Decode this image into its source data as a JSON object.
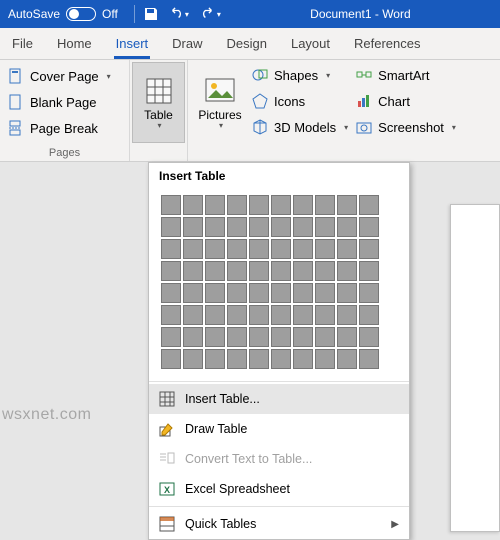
{
  "titlebar": {
    "autosave": {
      "label": "AutoSave",
      "state": "Off"
    },
    "document_title": "Document1 - Word"
  },
  "tabs": {
    "file": "File",
    "home": "Home",
    "insert": "Insert",
    "draw": "Draw",
    "design": "Design",
    "layout": "Layout",
    "references": "References"
  },
  "ribbon": {
    "pages": {
      "label": "Pages",
      "cover_page": "Cover Page",
      "blank_page": "Blank Page",
      "page_break": "Page Break"
    },
    "table_btn": {
      "label": "Table"
    },
    "pictures_btn": {
      "label": "Pictures"
    },
    "shapes": "Shapes",
    "icons": "Icons",
    "models": "3D Models",
    "smartart": "SmartArt",
    "chart": "Chart",
    "screenshot": "Screenshot"
  },
  "dropdown": {
    "title": "Insert Table",
    "grid_rows": 8,
    "grid_cols": 10,
    "items": {
      "insert_table": "Insert Table...",
      "draw_table": "Draw Table",
      "convert": "Convert Text to Table...",
      "excel": "Excel Spreadsheet",
      "quick": "Quick Tables"
    }
  },
  "watermark": "wsxnet.com"
}
